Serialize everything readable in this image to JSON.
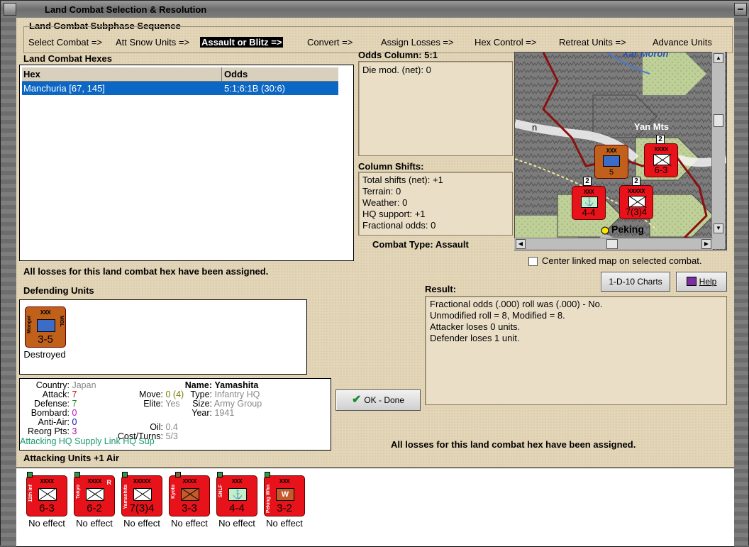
{
  "window": {
    "title": "Land Combat Selection & Resolution"
  },
  "sequence": {
    "title": "Land Combat Subphase Sequence",
    "steps": [
      "Select Combat =>",
      "Att Snow Units =>",
      "Assault or Blitz =>",
      "Convert =>",
      "Assign Losses =>",
      "Hex Control =>",
      "Retreat Units =>",
      "Advance Units"
    ]
  },
  "hexes": {
    "title": "Land Combat Hexes",
    "columns": [
      "Hex",
      "Odds"
    ],
    "rows": [
      {
        "hex": "Manchuria [67, 145]",
        "odds": "5:1;6:1B (30:6)"
      }
    ]
  },
  "odds": {
    "title": "Odds Column: 5:1",
    "die_mod": "Die mod. (net): 0"
  },
  "shifts": {
    "title": "Column Shifts:",
    "lines": [
      "Total shifts (net): +1",
      "Terrain: 0",
      "Weather: 0",
      "HQ support: +1",
      "Fractional odds: 0"
    ]
  },
  "combat_type": "Combat Type:  Assault",
  "map": {
    "labels": {
      "yan_mts": "Yan Mts",
      "peking": "Peking",
      "xar_moron": "Xar Moron",
      "letter_n": "n"
    },
    "counters": [
      {
        "size": "XXX",
        "strength": "5",
        "name": "Mongol",
        "color": "#c0601a"
      },
      {
        "size": "XXXX",
        "strength": "6-3",
        "name": "11th Inf",
        "color": "#e8121a"
      },
      {
        "size": "XXX",
        "strength": "4-4",
        "name": "SNLF",
        "color": "#e8121a"
      },
      {
        "size": "XXXXX",
        "strength": "7(3)4",
        "name": "Yamashita",
        "color": "#e8121a"
      }
    ],
    "badges": [
      "2",
      "2",
      "2"
    ],
    "center_label": "Center linked map on selected combat."
  },
  "status_message": "All losses for this land combat hex have been assigned.",
  "buttons": {
    "charts": "1-D-10 Charts",
    "help": "Help",
    "ok": "OK - Done"
  },
  "result": {
    "title": "Result:",
    "lines": [
      "Fractional odds (.000) roll was (.000)  - No.",
      "Unmodified roll = 8, Modified = 8.",
      "Attacker loses 0 units.",
      "Defender loses 1 unit."
    ]
  },
  "defending": {
    "title": "Defending Units",
    "units": [
      {
        "size": "XXX",
        "strength": "3-5",
        "name": "Mongol",
        "side": "MGL",
        "status": "Destroyed"
      }
    ]
  },
  "info": {
    "country_label": "Country:",
    "country": "Japan",
    "attack_label": "Attack:",
    "attack": "7",
    "defense_label": "Defense:",
    "defense": "7",
    "bombard_label": "Bombard:",
    "bombard": "0",
    "antiair_label": "Anti-Air:",
    "antiair": "0",
    "reorg_label": "Reorg Pts:",
    "reorg": "3",
    "move_label": "Move:",
    "move": "0 (4)",
    "elite_label": "Elite:",
    "elite": "Yes",
    "oil_label": "Oil:",
    "oil": "0.4",
    "cost_label": "Cost/Turns:",
    "cost": "5/3",
    "name_label": "Name:",
    "name": "Yamashita",
    "type_label": "Type:",
    "type": "Infantry HQ",
    "size_label": "Size:",
    "size": "Army Group",
    "year_label": "Year:",
    "year": "1941",
    "supply": "Attacking HQ Supply Link HQ Sup"
  },
  "attacking": {
    "title": "Attacking Units +1 Air",
    "units": [
      {
        "size": "XXXX",
        "strength": "6-3",
        "name": "11th Inf",
        "extra": "",
        "status": "No effect"
      },
      {
        "size": "XXXX",
        "strength": "6-2",
        "name": "Tokyo",
        "extra": "R",
        "status": "No effect"
      },
      {
        "size": "XXXXX",
        "strength": "7(3)4",
        "name": "Yamashita",
        "extra": "",
        "status": "No effect"
      },
      {
        "size": "XXXX",
        "strength": "3-3",
        "name": "Kyoto",
        "extra": "",
        "status": "No effect"
      },
      {
        "size": "XXX",
        "strength": "4-4",
        "name": "SNLF",
        "extra": "",
        "status": "No effect"
      },
      {
        "size": "XXX",
        "strength": "3-2",
        "name": "Peking Whn",
        "extra": "",
        "status": "No effect"
      }
    ]
  },
  "colors": {
    "accent_red": "#e8121a",
    "selection_blue": "#0b66c4",
    "parchment": "#e3d5b8"
  }
}
